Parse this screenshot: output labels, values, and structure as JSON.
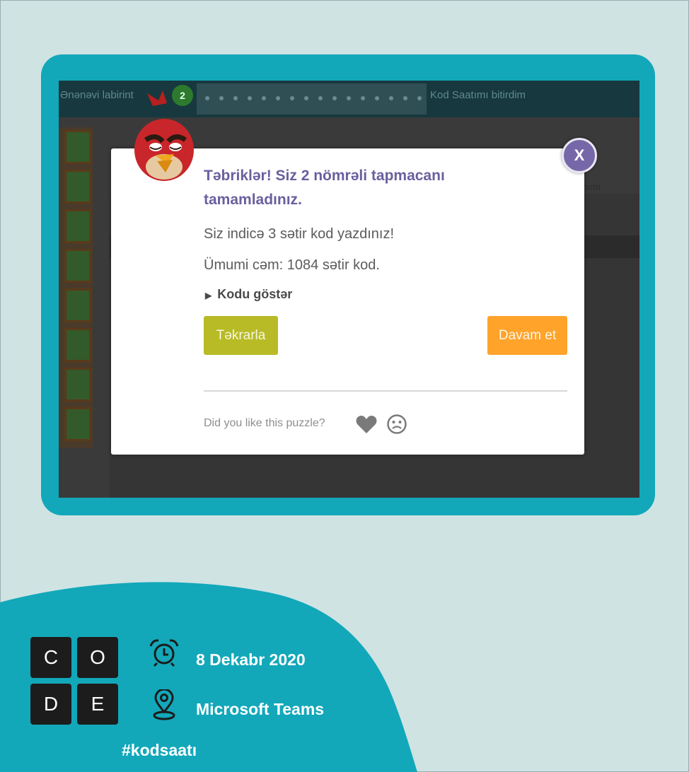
{
  "game": {
    "topbar_left": "Ənənəvi labirint",
    "progress_current": "2",
    "topbar_right": "Kod Saatımı bitirdim",
    "side_label": "bimi"
  },
  "dialog": {
    "title": "Təbriklər! Siz 2 nömrəli tapmacanı tamamladınız.",
    "lines_written": "Siz indicə 3 sətir kod yazdınız!",
    "total_lines": "Ümumi cəm: 1084 sətir kod.",
    "show_code": "Kodu göstər",
    "repeat_button": "Təkrarla",
    "continue_button": "Davam et",
    "close_label": "X",
    "feedback_prompt": "Did you like this puzzle?"
  },
  "branding": {
    "logo_letters": [
      "C",
      "O",
      "D",
      "E"
    ],
    "date": "8 Dekabr 2020",
    "location": "Microsoft Teams",
    "hashtag": "#kodsaatı"
  },
  "colors": {
    "teal": "#12a8ba",
    "background": "#cfe3e3",
    "repeat_button": "#b8bb26",
    "continue_button": "#ffa32b",
    "title_purple": "#6a5f9e"
  },
  "icons": {
    "avatar": "red-bird-avatar-icon",
    "close": "close-icon",
    "heart": "heart-icon",
    "sad": "sad-face-icon",
    "alarm": "alarm-clock-icon",
    "location": "location-pin-icon"
  }
}
